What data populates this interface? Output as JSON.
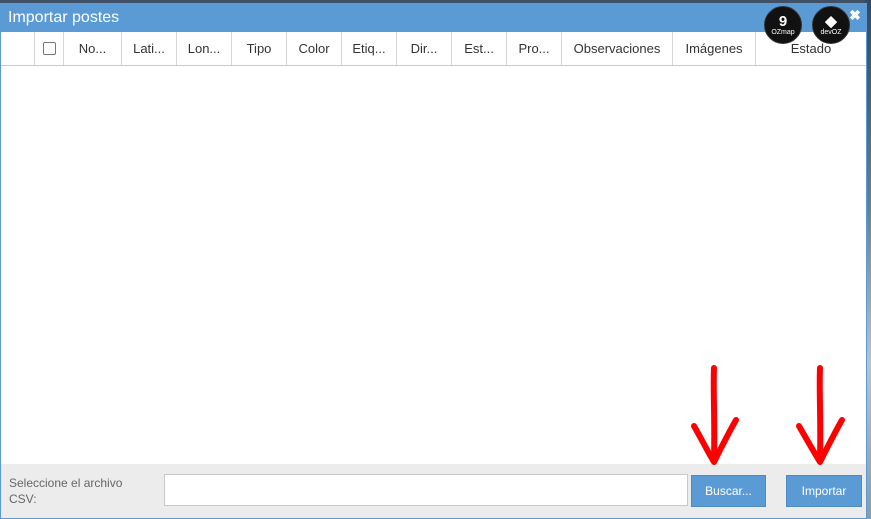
{
  "window": {
    "title": "Importar postes",
    "controls": {
      "refresh": "⟳",
      "close": "✖"
    }
  },
  "logos": [
    {
      "glyph": "9",
      "text": "OZmap"
    },
    {
      "glyph": "◆",
      "text": "devOZ"
    }
  ],
  "table": {
    "columns": [
      "No...",
      "Lati...",
      "Lon...",
      "Tipo",
      "Color",
      "Etiq...",
      "Dir...",
      "Est...",
      "Pro...",
      "Observaciones",
      "Imágenes",
      "Estado"
    ]
  },
  "footer": {
    "label": "Seleccione el archivo CSV:",
    "file_value": "",
    "buscar_label": "Buscar...",
    "importar_label": "Importar"
  },
  "colors": {
    "accent": "#5b9bd5",
    "annotation": "#ff0000"
  }
}
